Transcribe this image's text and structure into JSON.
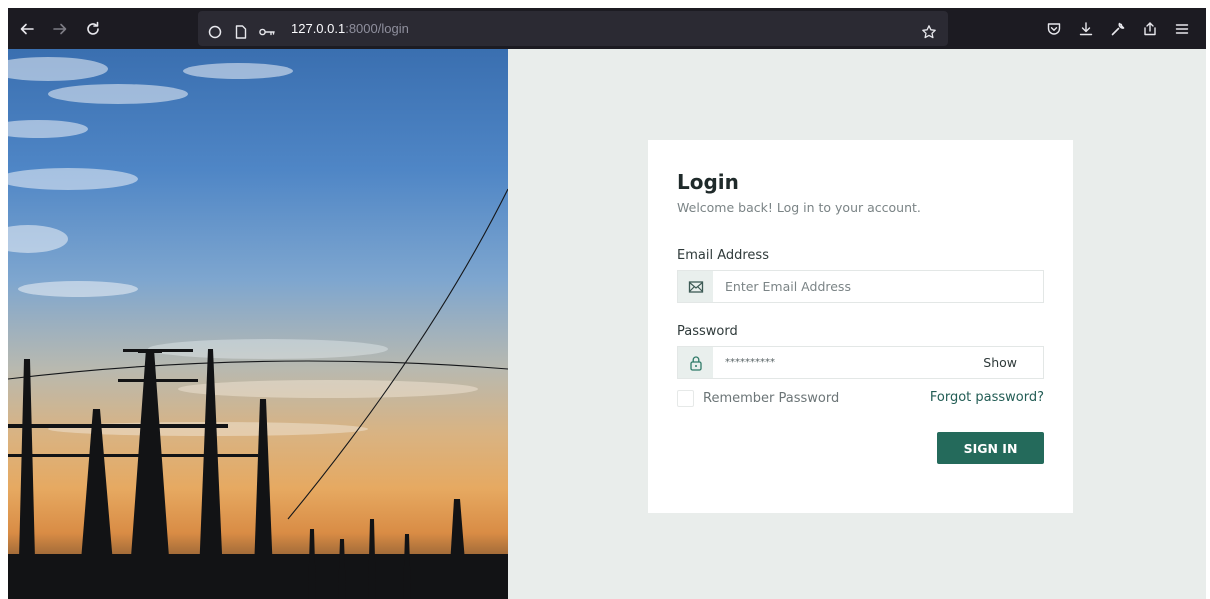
{
  "browser": {
    "url_host": "127.0.0.1",
    "url_path": ":8000/login"
  },
  "login": {
    "title": "Login",
    "subtitle": "Welcome back! Log in to your account.",
    "email_label": "Email Address",
    "email_placeholder": "Enter Email Address",
    "password_label": "Password",
    "password_value": "**********",
    "show_label": "Show",
    "remember_label": "Remember Password",
    "remember_checked": false,
    "forgot_label": "Forgot password?",
    "signin_label": "SIGN IN"
  },
  "colors": {
    "accent": "#246a5b",
    "link": "#235d55",
    "page_bg": "#e9edeb",
    "toolbar_bg": "#1c1b22"
  },
  "icons": {
    "back": "arrow-left-icon",
    "forward": "arrow-right-icon",
    "reload": "reload-icon",
    "tracking": "shield-icon",
    "page": "page-icon",
    "permissions": "key-icon",
    "bookmark": "star-icon",
    "pocket": "pocket-icon",
    "downloads": "download-icon",
    "tools": "wrench-icon",
    "share": "share-icon",
    "menu": "hamburger-menu-icon",
    "email": "envelope-icon",
    "password": "lock-icon"
  }
}
